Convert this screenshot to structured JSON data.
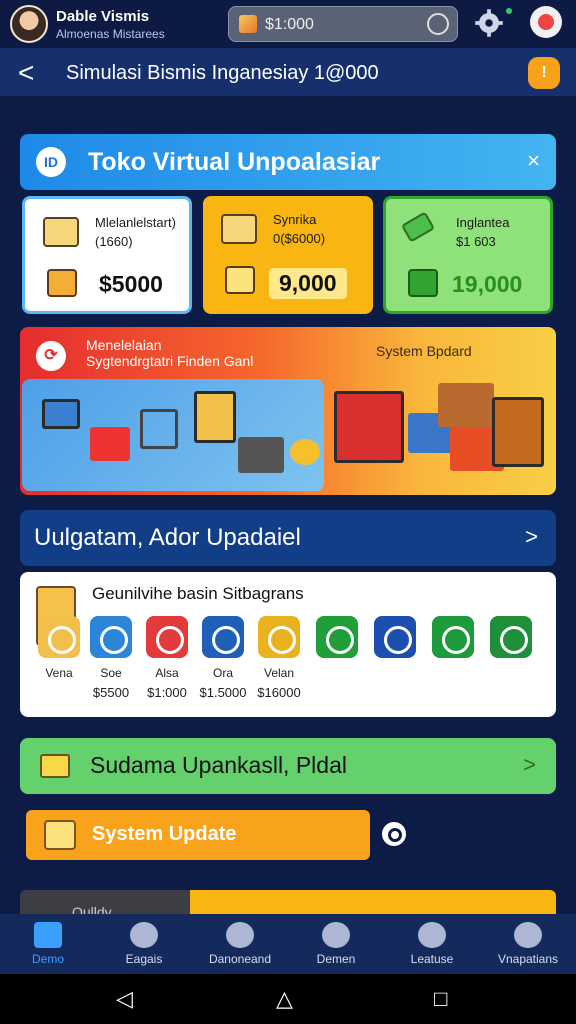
{
  "status_bar": {
    "user_name": "Dable Vismis",
    "user_subtitle": "Almoenas Mistarees",
    "balance": "$1:000",
    "icons": [
      "gear-icon",
      "mascot-icon"
    ]
  },
  "header": {
    "back_symbol": "<",
    "title": "Simulasi Bismis Inganesiay 1@000",
    "badge": "!"
  },
  "faint_link": "...",
  "store_card": {
    "icon": "ID",
    "title": "Toko Virtual Unpoalasiar",
    "close": "×"
  },
  "stats": [
    {
      "label": "Mlelanlelstart)",
      "sub": "(1660)",
      "value": "$5000"
    },
    {
      "label": "Synrika",
      "sub": "0($6000)",
      "value": "9,000"
    },
    {
      "label": "Inglantea",
      "sub": "$1 603",
      "value": "19,000"
    }
  ],
  "banner": {
    "title": "Menelelaian",
    "subtitle": "Sygtendrgtatri Finden Ganl",
    "tag": "System Bpdard"
  },
  "section": {
    "title": "Uulgatam, Ador Upadaiel",
    "chevron": ">"
  },
  "apps_card": {
    "title": "Geunilvihe basin Sitbagrans",
    "items": [
      {
        "label": "Vena",
        "price": "",
        "color": "#f1c04c"
      },
      {
        "label": "Soe",
        "price": "$5500",
        "color": "#2b86d9"
      },
      {
        "label": "Alsa",
        "price": "$1:000",
        "color": "#e23b3b"
      },
      {
        "label": "Ora",
        "price": "$1.5000",
        "color": "#1f5fb8"
      },
      {
        "label": "Velan",
        "price": "$16000",
        "color": "#e9b221"
      },
      {
        "label": "",
        "price": "",
        "color": "#1f9e3a"
      },
      {
        "label": "",
        "price": "",
        "color": "#1c4fb0"
      },
      {
        "label": "",
        "price": "",
        "color": "#1d9b3c"
      },
      {
        "label": "",
        "price": "",
        "color": "#1f8f3a"
      }
    ]
  },
  "green_card": {
    "title": "Sudama Upankasll, Pldal",
    "chevron": ">"
  },
  "update_button": {
    "label": "System Update"
  },
  "partial_label": "Oulldy",
  "bottom_nav": [
    {
      "label": "Demo",
      "color": "#3aa0ff"
    },
    {
      "label": "Eagais",
      "color": "#c8d0e8"
    },
    {
      "label": "Danoneand",
      "color": "#c8d0e8"
    },
    {
      "label": "Demen",
      "color": "#c8d0e8"
    },
    {
      "label": "Leatuse",
      "color": "#c8d0e8"
    },
    {
      "label": "Vnapatians",
      "color": "#c8d0e8"
    }
  ],
  "android_nav": {
    "back": "◁",
    "home": "△",
    "recent": "□"
  }
}
